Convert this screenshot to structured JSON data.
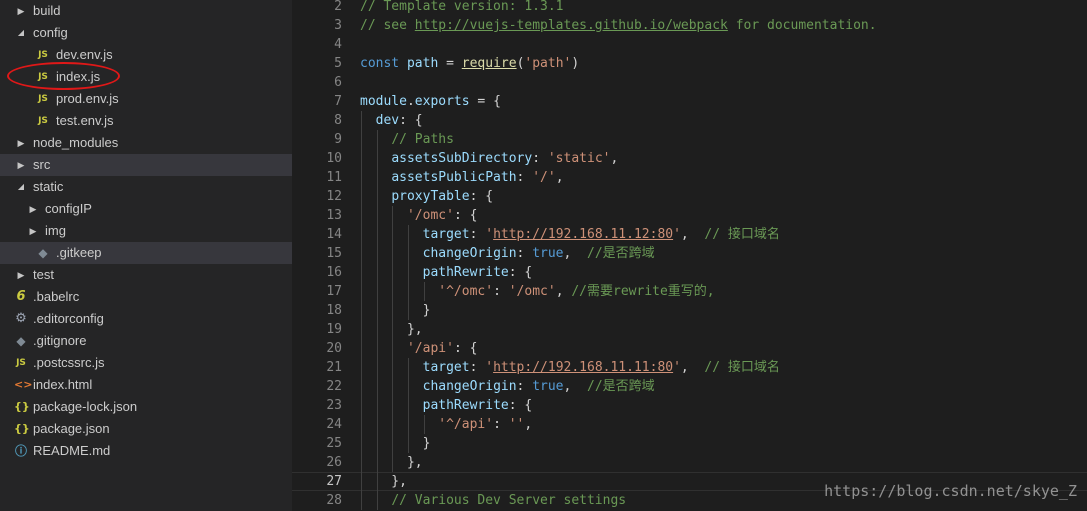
{
  "explorer": {
    "items": [
      {
        "label": "build",
        "type": "folder",
        "expanded": false,
        "indent": 0,
        "icon": "chevron-right"
      },
      {
        "label": "config",
        "type": "folder",
        "expanded": true,
        "indent": 0,
        "icon": "chevron-down"
      },
      {
        "label": "dev.env.js",
        "type": "file",
        "indent": 1,
        "icon": "js",
        "glyph": "JS"
      },
      {
        "label": "index.js",
        "type": "file",
        "indent": 1,
        "icon": "js",
        "glyph": "JS"
      },
      {
        "label": "prod.env.js",
        "type": "file",
        "indent": 1,
        "icon": "js",
        "glyph": "JS"
      },
      {
        "label": "test.env.js",
        "type": "file",
        "indent": 1,
        "icon": "js",
        "glyph": "JS"
      },
      {
        "label": "node_modules",
        "type": "folder",
        "expanded": false,
        "indent": 0,
        "icon": "chevron-right"
      },
      {
        "label": "src",
        "type": "folder",
        "expanded": false,
        "indent": 0,
        "icon": "chevron-right",
        "selected": true
      },
      {
        "label": "static",
        "type": "folder",
        "expanded": true,
        "indent": 0,
        "icon": "chevron-down"
      },
      {
        "label": "configIP",
        "type": "folder",
        "expanded": false,
        "indent": 1,
        "icon": "chevron-right"
      },
      {
        "label": "img",
        "type": "folder",
        "expanded": false,
        "indent": 1,
        "icon": "chevron-right"
      },
      {
        "label": ".gitkeep",
        "type": "file",
        "indent": 1,
        "icon": "git",
        "glyph": "◆",
        "selected": true
      },
      {
        "label": "test",
        "type": "folder",
        "expanded": false,
        "indent": 0,
        "icon": "chevron-right"
      },
      {
        "label": ".babelrc",
        "type": "file",
        "indent": 0,
        "icon": "babel",
        "glyph": "6"
      },
      {
        "label": ".editorconfig",
        "type": "file",
        "indent": 0,
        "icon": "gear",
        "glyph": "⚙"
      },
      {
        "label": ".gitignore",
        "type": "file",
        "indent": 0,
        "icon": "git",
        "glyph": "◆"
      },
      {
        "label": ".postcssrc.js",
        "type": "file",
        "indent": 0,
        "icon": "js",
        "glyph": "JS"
      },
      {
        "label": "index.html",
        "type": "file",
        "indent": 0,
        "icon": "html",
        "glyph": "<>"
      },
      {
        "label": "package-lock.json",
        "type": "file",
        "indent": 0,
        "icon": "json",
        "glyph": "{}"
      },
      {
        "label": "package.json",
        "type": "file",
        "indent": 0,
        "icon": "json",
        "glyph": "{}"
      },
      {
        "label": "README.md",
        "type": "file",
        "indent": 0,
        "icon": "info",
        "glyph": "ⓘ"
      }
    ]
  },
  "editor": {
    "active_line": 27,
    "lines": [
      {
        "num": "2",
        "guides": 0,
        "tokens": [
          {
            "t": "// Template version: 1.3.1",
            "c": "comment"
          }
        ]
      },
      {
        "num": "3",
        "guides": 0,
        "tokens": [
          {
            "t": "// see ",
            "c": "comment"
          },
          {
            "t": "http://vuejs-templates.github.io/webpack",
            "c": "comment",
            "link": true
          },
          {
            "t": " for documentation.",
            "c": "comment"
          }
        ]
      },
      {
        "num": "4",
        "guides": 0,
        "tokens": []
      },
      {
        "num": "5",
        "guides": 0,
        "tokens": [
          {
            "t": "const",
            "c": "keyword"
          },
          {
            "t": " ",
            "c": "plain"
          },
          {
            "t": "path",
            "c": "var"
          },
          {
            "t": " = ",
            "c": "plain"
          },
          {
            "t": "require",
            "c": "func",
            "link": true
          },
          {
            "t": "(",
            "c": "plain"
          },
          {
            "t": "'path'",
            "c": "string"
          },
          {
            "t": ")",
            "c": "plain"
          }
        ]
      },
      {
        "num": "6",
        "guides": 0,
        "tokens": []
      },
      {
        "num": "7",
        "guides": 0,
        "tokens": [
          {
            "t": "module",
            "c": "var"
          },
          {
            "t": ".",
            "c": "plain"
          },
          {
            "t": "exports",
            "c": "var"
          },
          {
            "t": " = {",
            "c": "plain"
          }
        ]
      },
      {
        "num": "8",
        "guides": 1,
        "tokens": [
          {
            "t": "  ",
            "c": "plain"
          },
          {
            "t": "dev",
            "c": "var"
          },
          {
            "t": ": {",
            "c": "plain"
          }
        ]
      },
      {
        "num": "9",
        "guides": 2,
        "tokens": [
          {
            "t": "    ",
            "c": "plain"
          },
          {
            "t": "// Paths",
            "c": "comment"
          }
        ]
      },
      {
        "num": "10",
        "guides": 2,
        "tokens": [
          {
            "t": "    ",
            "c": "plain"
          },
          {
            "t": "assetsSubDirectory",
            "c": "var"
          },
          {
            "t": ": ",
            "c": "plain"
          },
          {
            "t": "'static'",
            "c": "string"
          },
          {
            "t": ",",
            "c": "plain"
          }
        ]
      },
      {
        "num": "11",
        "guides": 2,
        "tokens": [
          {
            "t": "    ",
            "c": "plain"
          },
          {
            "t": "assetsPublicPath",
            "c": "var"
          },
          {
            "t": ": ",
            "c": "plain"
          },
          {
            "t": "'/'",
            "c": "string"
          },
          {
            "t": ",",
            "c": "plain"
          }
        ]
      },
      {
        "num": "12",
        "guides": 2,
        "tokens": [
          {
            "t": "    ",
            "c": "plain"
          },
          {
            "t": "proxyTable",
            "c": "var"
          },
          {
            "t": ": {",
            "c": "plain"
          }
        ]
      },
      {
        "num": "13",
        "guides": 3,
        "tokens": [
          {
            "t": "      ",
            "c": "plain"
          },
          {
            "t": "'/omc'",
            "c": "string"
          },
          {
            "t": ": {",
            "c": "plain"
          }
        ]
      },
      {
        "num": "14",
        "guides": 4,
        "tokens": [
          {
            "t": "        ",
            "c": "plain"
          },
          {
            "t": "target",
            "c": "var"
          },
          {
            "t": ": ",
            "c": "plain"
          },
          {
            "t": "'",
            "c": "string"
          },
          {
            "t": "http://192.168.11.12:80",
            "c": "string",
            "link": true
          },
          {
            "t": "'",
            "c": "string"
          },
          {
            "t": ",  ",
            "c": "plain"
          },
          {
            "t": "// 接口域名",
            "c": "comment"
          }
        ]
      },
      {
        "num": "15",
        "guides": 4,
        "tokens": [
          {
            "t": "        ",
            "c": "plain"
          },
          {
            "t": "changeOrigin",
            "c": "var"
          },
          {
            "t": ": ",
            "c": "plain"
          },
          {
            "t": "true",
            "c": "keyword"
          },
          {
            "t": ",  ",
            "c": "plain"
          },
          {
            "t": "//是否跨域",
            "c": "comment"
          }
        ]
      },
      {
        "num": "16",
        "guides": 4,
        "tokens": [
          {
            "t": "        ",
            "c": "plain"
          },
          {
            "t": "pathRewrite",
            "c": "var"
          },
          {
            "t": ": {",
            "c": "plain"
          }
        ]
      },
      {
        "num": "17",
        "guides": 5,
        "tokens": [
          {
            "t": "          ",
            "c": "plain"
          },
          {
            "t": "'^/omc'",
            "c": "string"
          },
          {
            "t": ": ",
            "c": "plain"
          },
          {
            "t": "'/omc'",
            "c": "string"
          },
          {
            "t": ", ",
            "c": "plain"
          },
          {
            "t": "//需要rewrite重写的,",
            "c": "comment"
          }
        ]
      },
      {
        "num": "18",
        "guides": 4,
        "tokens": [
          {
            "t": "        }",
            "c": "plain"
          }
        ]
      },
      {
        "num": "19",
        "guides": 3,
        "tokens": [
          {
            "t": "      },",
            "c": "plain"
          }
        ]
      },
      {
        "num": "20",
        "guides": 3,
        "tokens": [
          {
            "t": "      ",
            "c": "plain"
          },
          {
            "t": "'/api'",
            "c": "string"
          },
          {
            "t": ": {",
            "c": "plain"
          }
        ]
      },
      {
        "num": "21",
        "guides": 4,
        "tokens": [
          {
            "t": "        ",
            "c": "plain"
          },
          {
            "t": "target",
            "c": "var"
          },
          {
            "t": ": ",
            "c": "plain"
          },
          {
            "t": "'",
            "c": "string"
          },
          {
            "t": "http://192.168.11.11:80",
            "c": "string",
            "link": true
          },
          {
            "t": "'",
            "c": "string"
          },
          {
            "t": ",  ",
            "c": "plain"
          },
          {
            "t": "// 接口域名",
            "c": "comment"
          }
        ]
      },
      {
        "num": "22",
        "guides": 4,
        "tokens": [
          {
            "t": "        ",
            "c": "plain"
          },
          {
            "t": "changeOrigin",
            "c": "var"
          },
          {
            "t": ": ",
            "c": "plain"
          },
          {
            "t": "true",
            "c": "keyword"
          },
          {
            "t": ",  ",
            "c": "plain"
          },
          {
            "t": "//是否跨域",
            "c": "comment"
          }
        ]
      },
      {
        "num": "23",
        "guides": 4,
        "tokens": [
          {
            "t": "        ",
            "c": "plain"
          },
          {
            "t": "pathRewrite",
            "c": "var"
          },
          {
            "t": ": {",
            "c": "plain"
          }
        ]
      },
      {
        "num": "24",
        "guides": 5,
        "tokens": [
          {
            "t": "          ",
            "c": "plain"
          },
          {
            "t": "'^/api'",
            "c": "string"
          },
          {
            "t": ": ",
            "c": "plain"
          },
          {
            "t": "''",
            "c": "string"
          },
          {
            "t": ",",
            "c": "plain"
          }
        ]
      },
      {
        "num": "25",
        "guides": 4,
        "tokens": [
          {
            "t": "        }",
            "c": "plain"
          }
        ]
      },
      {
        "num": "26",
        "guides": 3,
        "tokens": [
          {
            "t": "      },",
            "c": "plain"
          }
        ]
      },
      {
        "num": "27",
        "guides": 2,
        "tokens": [
          {
            "t": "    },",
            "c": "plain"
          }
        ]
      },
      {
        "num": "28",
        "guides": 2,
        "tokens": [
          {
            "t": "    ",
            "c": "plain"
          },
          {
            "t": "// Various Dev Server settings",
            "c": "comment"
          }
        ]
      }
    ]
  },
  "watermark": {
    "text": "https://blog.csdn.net/skye_Z"
  },
  "colors": {
    "sidebar_bg": "#252526",
    "editor_bg": "#1e1e1e",
    "selection_bg": "#37373d",
    "annotation_red": "#e01818"
  }
}
